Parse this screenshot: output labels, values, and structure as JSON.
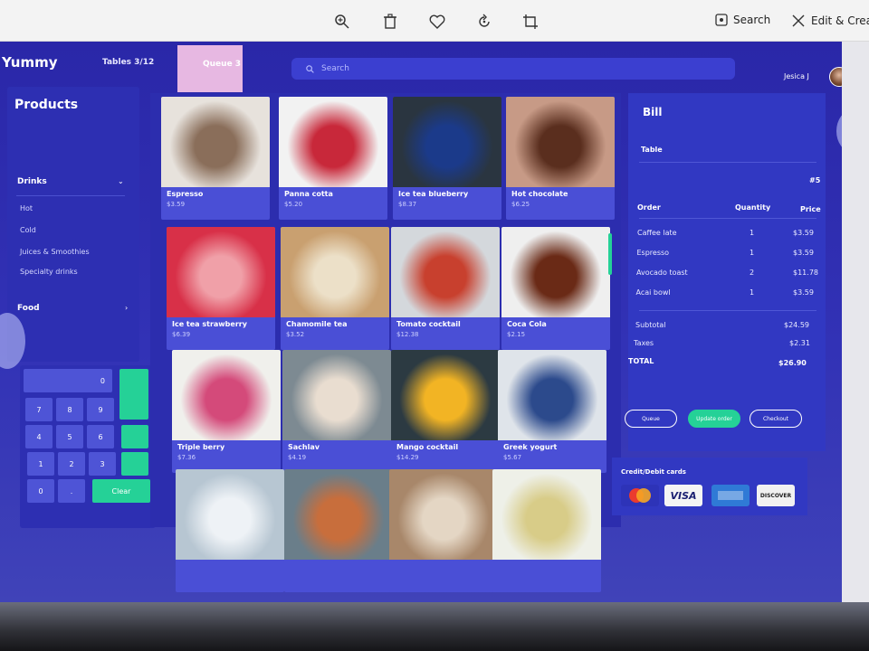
{
  "viewer": {
    "search_label": "Search",
    "edit_label": "Edit & Creat"
  },
  "app": {
    "brand": "Yummy",
    "tables": "Tables 3/12",
    "queue": "Queue 3",
    "search_placeholder": "Search",
    "user": "Jesica J"
  },
  "products": {
    "title": "Products",
    "drinks": "Drinks",
    "drink_items": [
      "Hot",
      "Cold",
      "Juices & Smoothies",
      "Specialty drinks"
    ],
    "food": "Food"
  },
  "keypad": {
    "keys": [
      "0",
      "7",
      "8",
      "9",
      "4",
      "5",
      "6",
      "1",
      "2",
      "3",
      "0",
      "."
    ],
    "clear": "Clear"
  },
  "menu": [
    {
      "name": "Espresso",
      "price": "$3.59"
    },
    {
      "name": "Panna cotta",
      "price": "$5.20"
    },
    {
      "name": "Ice tea blueberry",
      "price": "$8.37"
    },
    {
      "name": "Hot chocolate",
      "price": "$6.25"
    },
    {
      "name": "Ice tea strawberry",
      "price": "$6.39"
    },
    {
      "name": "Chamomile tea",
      "price": "$3.52"
    },
    {
      "name": "Tomato cocktail",
      "price": "$12.38"
    },
    {
      "name": "Coca Cola",
      "price": "$2.15"
    },
    {
      "name": "Triple berry",
      "price": "$7.36"
    },
    {
      "name": "Sachlav",
      "price": "$4.19"
    },
    {
      "name": "Mango cocktail",
      "price": "$14.29"
    },
    {
      "name": "Greek yogurt",
      "price": "$5.67"
    },
    {
      "name": "",
      "price": ""
    },
    {
      "name": "",
      "price": ""
    },
    {
      "name": "",
      "price": ""
    },
    {
      "name": "",
      "price": ""
    }
  ],
  "bill": {
    "title": "Bill",
    "table_label": "Table",
    "table_number": "#5",
    "col_order": "Order",
    "col_quantity": "Quantity",
    "col_price": "Price",
    "items": [
      {
        "name": "Caffee late",
        "qty": "1",
        "price": "$3.59"
      },
      {
        "name": "Espresso",
        "qty": "1",
        "price": "$3.59"
      },
      {
        "name": "Avocado toast",
        "qty": "2",
        "price": "$11.78"
      },
      {
        "name": "Acai bowl",
        "qty": "1",
        "price": "$3.59"
      }
    ],
    "subtotal_label": "Subtotal",
    "subtotal": "$24.59",
    "taxes_label": "Taxes",
    "taxes": "$2.31",
    "total_label": "TOTAL",
    "total": "$26.90",
    "btn_queue": "Queue",
    "btn_update": "Update order",
    "btn_checkout": "Checkout",
    "cards_title": "Credit/Debit cards",
    "card_visa": "VISA",
    "card_discover": "DISCOVER"
  }
}
